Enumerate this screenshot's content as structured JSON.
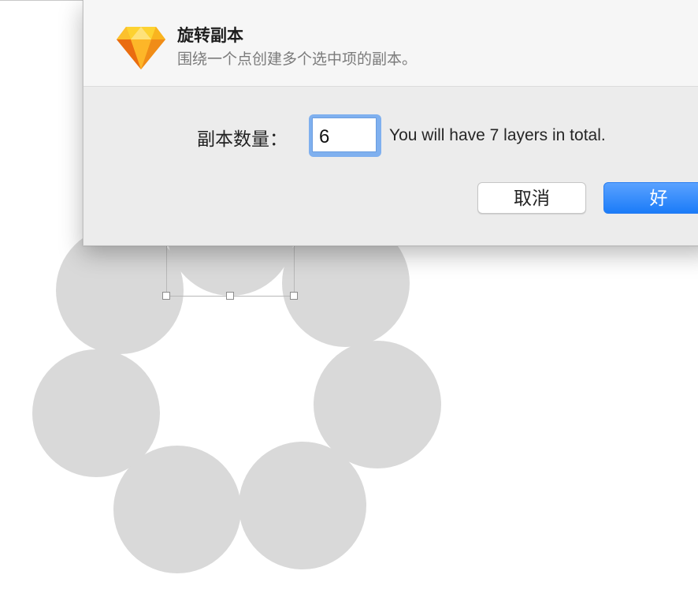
{
  "dialog": {
    "title": "旋转副本",
    "subtitle": "围绕一个点创建多个选中项的副本。",
    "app_icon": "sketch-diamond-icon",
    "copies_label": "副本数量：",
    "copies_value": "6",
    "total_text": "You will have 7 layers in total.",
    "cancel_label": "取消",
    "ok_label": "好"
  },
  "canvas": {
    "shape": "circle",
    "shape_color": "#d9d9d9",
    "circle_count": 7
  },
  "colors": {
    "accent": "#1b7cf8",
    "focus_ring": "#7fb0ef",
    "icon_orange": "#f7a21b",
    "icon_yellow": "#fdd231"
  }
}
